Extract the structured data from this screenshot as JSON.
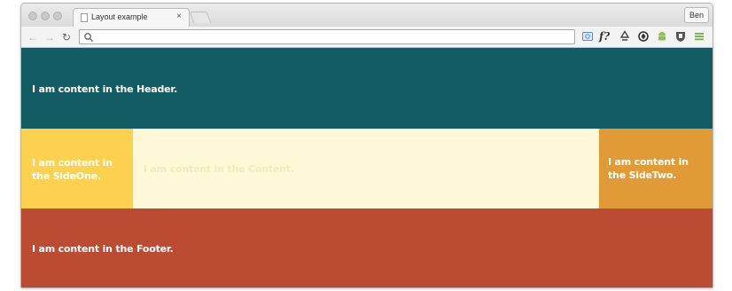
{
  "browser": {
    "tab": {
      "title": "Layout example",
      "close_symbol": "×"
    },
    "profile_name": "Ben",
    "omnibox": {
      "value": ""
    },
    "extensions": [
      "screenshot-icon",
      "font-finder-icon",
      "recycle-icon",
      "circle-arrows-icon",
      "android-icon",
      "shield-icon",
      "hamburger-menu-icon"
    ],
    "ext_fontfinder_label": "f?"
  },
  "page": {
    "header_text": "I am content in the Header.",
    "side_one_text": "I am content in the SideOne.",
    "content_text": "I am content in the Content.",
    "side_two_text": "I am content in the SideTwo.",
    "footer_text": "I am content in the Footer."
  },
  "colors": {
    "header": "#135c63",
    "side_one": "#fdd150",
    "content": "#fef8d7",
    "side_two": "#e09b37",
    "footer": "#bb4b32"
  }
}
